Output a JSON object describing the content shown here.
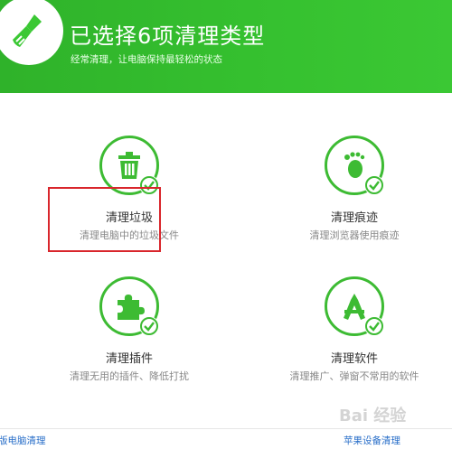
{
  "header": {
    "title": "已选择6项清理类型",
    "subtitle": "经常清理，让电脑保持最轻松的状态",
    "icon": "broom-icon"
  },
  "colors": {
    "header_green": "#35c02f",
    "icon_green": "#3dbb33",
    "highlight_red": "#d9262c",
    "link_blue": "#2a6fc9"
  },
  "tiles": [
    {
      "icon": "trash-can-icon",
      "checked": true,
      "title": "清理垃圾",
      "desc": "清理电脑中的垃圾文件"
    },
    {
      "icon": "footprint-icon",
      "checked": true,
      "title": "清理痕迹",
      "desc": "清理浏览器使用痕迹"
    },
    {
      "icon": "puzzle-piece-icon",
      "checked": true,
      "title": "清理插件",
      "desc": "清理无用的插件、降低打扰"
    },
    {
      "icon": "app-store-icon",
      "checked": true,
      "title": "清理软件",
      "desc": "清理推广、弹窗不常用的软件"
    }
  ],
  "bottom": {
    "left_link": "版电脑清理",
    "right_link": "苹果设备清理"
  },
  "watermark": "Bai 经验"
}
